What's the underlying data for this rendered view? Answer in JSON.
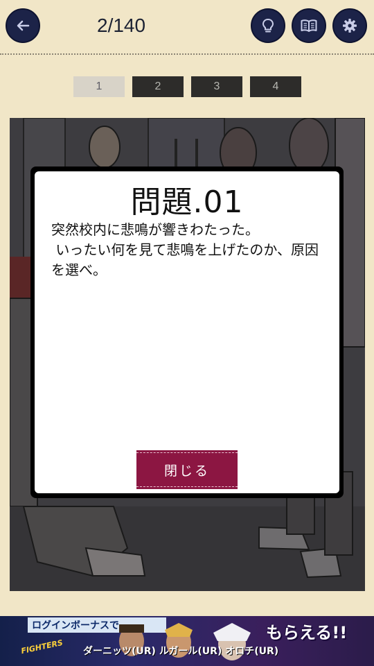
{
  "header": {
    "progress": "2/140",
    "icons": [
      "back-arrow-icon",
      "lightbulb-icon",
      "book-icon",
      "gear-icon"
    ]
  },
  "tabs": [
    {
      "label": "1",
      "selected": true
    },
    {
      "label": "2",
      "selected": false
    },
    {
      "label": "3",
      "selected": false
    },
    {
      "label": "4",
      "selected": false
    }
  ],
  "modal": {
    "title": "問題.01",
    "body": "突然校内に悲鳴が響きわたった。\n いったい何を見て悲鳴を上げたのか、原因を選べ。",
    "close_label": "閉じる"
  },
  "banner": {
    "login_text": "ログインボーナスで",
    "logo_text": "FIGHTERS",
    "characters_text": "ダーニッツ(UR) ルガール(UR) オロチ(UR)",
    "cta": "もらえる!!"
  },
  "colors": {
    "background": "#f1e6c7",
    "header_button": "#1c2348",
    "close_button": "#8c1642",
    "tab_selected": "#d8d3c8",
    "tab_default": "#2d2c2a"
  }
}
